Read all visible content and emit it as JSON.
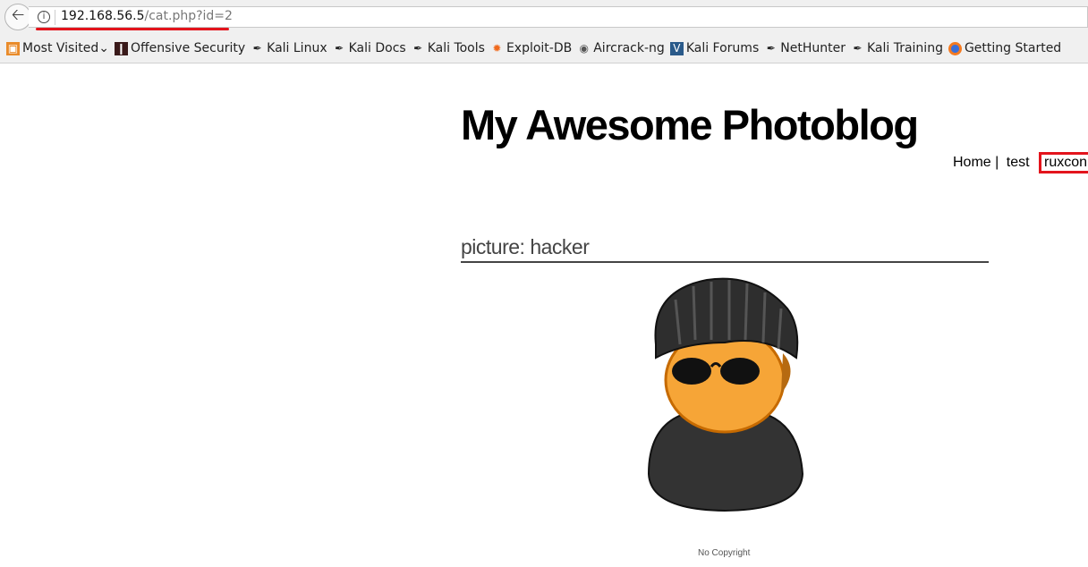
{
  "browser": {
    "url_host": "192.168.56.5",
    "url_path": "/cat.php?id=2",
    "bookmarks": [
      {
        "label": "Most Visited",
        "icon": "folder-icon"
      },
      {
        "label": "Offensive Security",
        "icon": "offsec-icon"
      },
      {
        "label": "Kali Linux",
        "icon": "kali-icon"
      },
      {
        "label": "Kali Docs",
        "icon": "kali-icon"
      },
      {
        "label": "Kali Tools",
        "icon": "kali-icon"
      },
      {
        "label": "Exploit-DB",
        "icon": "exploitdb-icon"
      },
      {
        "label": "Aircrack-ng",
        "icon": "aircrack-icon"
      },
      {
        "label": "Kali Forums",
        "icon": "forums-icon"
      },
      {
        "label": "NetHunter",
        "icon": "kali-icon"
      },
      {
        "label": "Kali Training",
        "icon": "kali-icon"
      },
      {
        "label": "Getting Started",
        "icon": "firefox-icon"
      }
    ]
  },
  "site": {
    "title": "My Awesome Photoblog",
    "nav": [
      "Home",
      "test",
      "ruxcon"
    ],
    "sep": "|"
  },
  "picture": {
    "heading": "picture: hacker",
    "alt": "hacker"
  },
  "footer": "No Copyright",
  "colors": {
    "highlight": "#e3141c"
  }
}
